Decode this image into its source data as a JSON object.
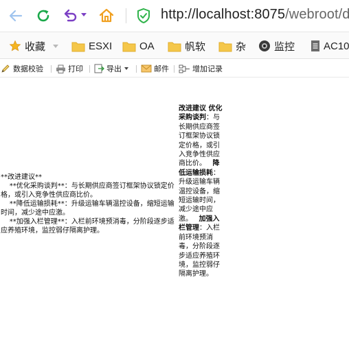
{
  "browser": {
    "url_host": "http://localhost:8075",
    "url_path": "/webroot/d"
  },
  "bookmarks": [
    {
      "label": "收藏",
      "icon": "star-icon"
    },
    {
      "label": "ESXI",
      "icon": "folder-icon"
    },
    {
      "label": "OA",
      "icon": "folder-icon"
    },
    {
      "label": "帆软",
      "icon": "folder-icon"
    },
    {
      "label": "杂",
      "icon": "folder-icon"
    },
    {
      "label": "监控",
      "icon": "camera-icon"
    },
    {
      "label": "AC10",
      "icon": "page-icon"
    }
  ],
  "toolbar": {
    "validate": "数据校验",
    "print": "打印",
    "export": "导出",
    "mail": "邮件",
    "add_record": "增加记录"
  },
  "report": {
    "left_text": "**改进建议**\n    **优化采购谈判**：与长期供应商签订框架协议锁定价格，或引入竞争性供应商比价。\n    **降低运输损耗**：升级运输车辆温控设备，缩短运输时间，减少途中应激。\n    **加强入栏管理**：入栏前环境预消毒，分阶段逐步适应养殖环境，监控弱仔隔离护理。",
    "right_h1": "改进建议 优化采购谈判",
    "right_t1": "：与长期供应商签订框架协议锁定价格，或引入竞争性供应商比价。",
    "right_h2": "降低运输损耗",
    "right_t2": "：升级运输车辆温控设备，缩短运输时间，减少途中应激。",
    "right_h3": "加强入栏管理",
    "right_t3": "：入栏前环境预消毒，分阶段逐步适应养殖环境，监控弱仔隔离护理。"
  },
  "colors": {
    "back_arrow": "#9fc4ef",
    "refresh": "#1aa84a",
    "undo": "#7b3fc4",
    "home": "#f0a020",
    "shield": "#2fb34a",
    "folder": "#f5c74a"
  }
}
